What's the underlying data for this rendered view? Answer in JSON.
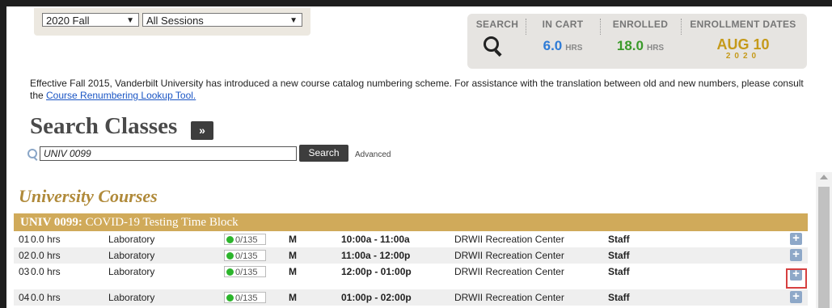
{
  "filters": {
    "term": "2020 Fall",
    "session": "All Sessions"
  },
  "summary": {
    "search_label": "SEARCH",
    "in_cart_label": "IN CART",
    "in_cart_value": "6.0",
    "enrolled_label": "ENROLLED",
    "enrolled_value": "18.0",
    "hours_unit": "HRS",
    "dates_label": "ENROLLMENT DATES",
    "date_value": "AUG 10",
    "date_year": "2020",
    "in_cart_color": "#2e7bd6",
    "enrolled_color": "#3a9a2a",
    "date_color": "#c59a1a"
  },
  "notice": {
    "text": "Effective Fall 2015, Vanderbilt University has introduced a new course catalog numbering scheme. For assistance with the translation between old and new numbers, please consult the ",
    "link_text": "Course Renumbering Lookup Tool."
  },
  "search": {
    "title": "Search Classes",
    "expand_label": "»",
    "query": "UNIV 0099",
    "button_label": "Search",
    "advanced_label": "Advanced"
  },
  "results": {
    "section_title": "University Courses",
    "course_code": "UNIV 0099:",
    "course_name": "COVID-19 Testing Time Block",
    "rows": [
      {
        "section": "01",
        "hours": "0.0 hrs",
        "type": "Laboratory",
        "seats": "0/135",
        "days": "M",
        "time": "10:00a - 11:00a",
        "location": "DRWII Recreation Center",
        "instructor": "Staff"
      },
      {
        "section": "02",
        "hours": "0.0 hrs",
        "type": "Laboratory",
        "seats": "0/135",
        "days": "M",
        "time": "11:00a - 12:00p",
        "location": "DRWII Recreation Center",
        "instructor": "Staff"
      },
      {
        "section": "03",
        "hours": "0.0 hrs",
        "type": "Laboratory",
        "seats": "0/135",
        "days": "M",
        "time": "12:00p - 01:00p",
        "location": "DRWII Recreation Center",
        "instructor": "Staff"
      },
      {
        "section": "04",
        "hours": "0.0 hrs",
        "type": "Laboratory",
        "seats": "0/135",
        "days": "M",
        "time": "01:00p - 02:00p",
        "location": "DRWII Recreation Center",
        "instructor": "Staff"
      }
    ],
    "add_icon": "plus-icon"
  }
}
